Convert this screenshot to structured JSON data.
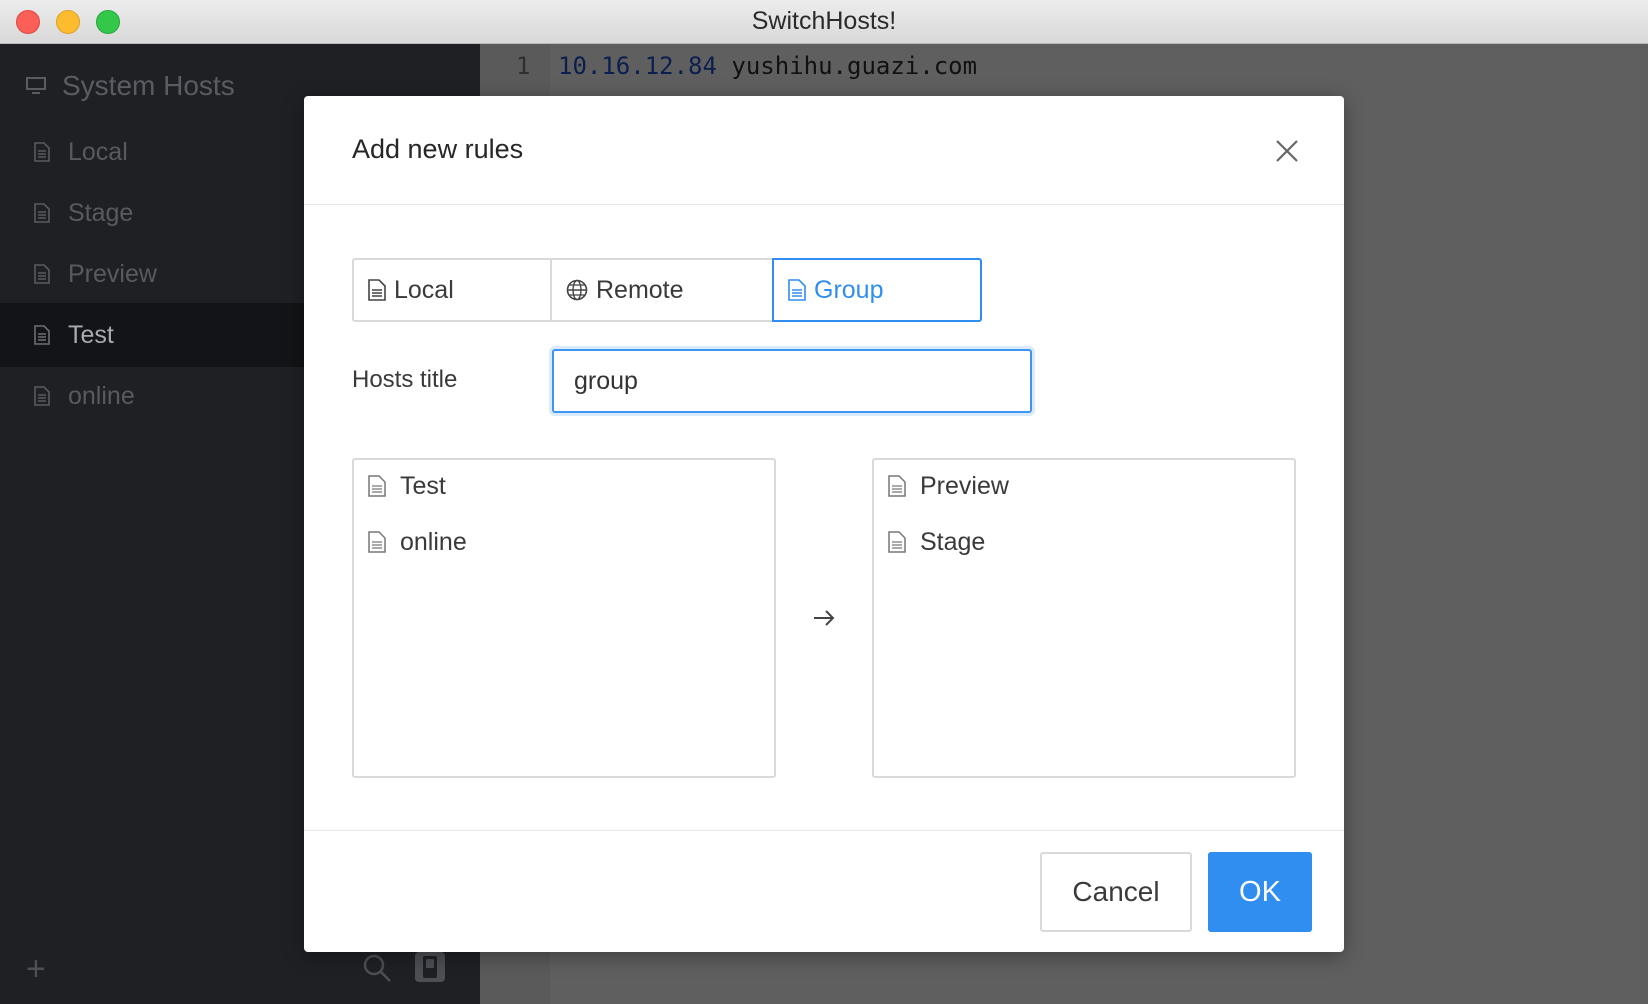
{
  "window": {
    "title": "SwitchHosts!"
  },
  "sidebar": {
    "system_hosts": {
      "label": "System Hosts",
      "icon": "monitor-icon"
    },
    "items": [
      {
        "label": "Local",
        "icon": "document-icon",
        "active": false
      },
      {
        "label": "Stage",
        "icon": "document-icon",
        "active": false
      },
      {
        "label": "Preview",
        "icon": "document-icon",
        "active": false
      },
      {
        "label": "Test",
        "icon": "document-icon",
        "active": true
      },
      {
        "label": "online",
        "icon": "document-icon",
        "active": false
      }
    ],
    "footer": {
      "add": "+",
      "search_icon": "search-icon",
      "toggle_icon": "toggle-icon"
    }
  },
  "editor": {
    "line_number": "1",
    "line_ip": "10.16.12.84",
    "line_host": "yushihu.guazi.com"
  },
  "dialog": {
    "title": "Add new rules",
    "close_icon": "close-icon",
    "tabs": [
      {
        "label": "Local",
        "icon": "document-icon"
      },
      {
        "label": "Remote",
        "icon": "globe-icon"
      },
      {
        "label": "Group",
        "icon": "document-icon",
        "selected": true
      }
    ],
    "hosts_title_label": "Hosts title",
    "hosts_title_value": "group",
    "available_list": [
      "Test",
      "online"
    ],
    "selected_list": [
      "Preview",
      "Stage"
    ],
    "transfer_icon": "arrow-right-icon",
    "cancel_label": "Cancel",
    "ok_label": "OK"
  },
  "colors": {
    "accent": "#2f8ef0",
    "sidebar_bg": "#1f2024",
    "editor_bg": "#5f5f5f"
  }
}
